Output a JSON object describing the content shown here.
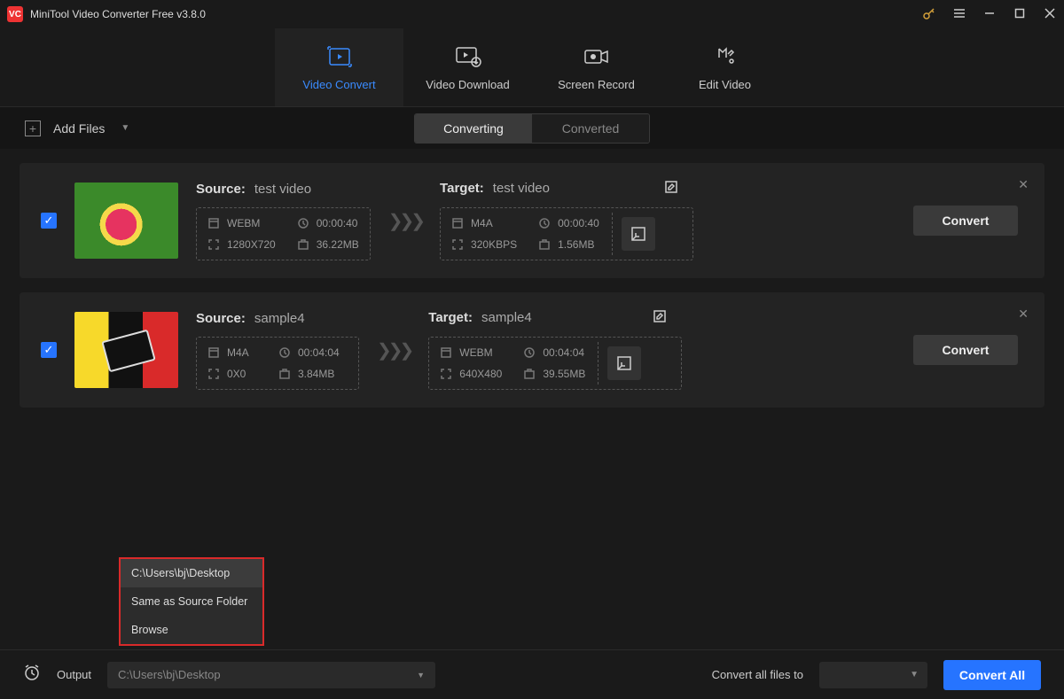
{
  "app": {
    "title": "MiniTool Video Converter Free v3.8.0"
  },
  "nav": {
    "convert": "Video Convert",
    "download": "Video Download",
    "record": "Screen Record",
    "edit": "Edit Video"
  },
  "toolbar": {
    "addfiles": "Add Files",
    "converting": "Converting",
    "converted": "Converted"
  },
  "items": [
    {
      "source_label": "Source:",
      "source_name": "test video",
      "src_format": "WEBM",
      "src_dur": "00:00:40",
      "src_res": "1280X720",
      "src_size": "36.22MB",
      "target_label": "Target:",
      "target_name": "test video",
      "tgt_format": "M4A",
      "tgt_dur": "00:00:40",
      "tgt_res": "320KBPS",
      "tgt_size": "1.56MB",
      "btn": "Convert"
    },
    {
      "source_label": "Source:",
      "source_name": "sample4",
      "src_format": "M4A",
      "src_dur": "00:04:04",
      "src_res": "0X0",
      "src_size": "3.84MB",
      "target_label": "Target:",
      "target_name": "sample4",
      "tgt_format": "WEBM",
      "tgt_dur": "00:04:04",
      "tgt_res": "640X480",
      "tgt_size": "39.55MB",
      "btn": "Convert"
    }
  ],
  "popup": {
    "opt0": "C:\\Users\\bj\\Desktop",
    "opt1": "Same as Source Folder",
    "opt2": "Browse"
  },
  "bottom": {
    "output_label": "Output",
    "output_path": "C:\\Users\\bj\\Desktop",
    "convert_all_to": "Convert all files to",
    "convert_all": "Convert All"
  }
}
